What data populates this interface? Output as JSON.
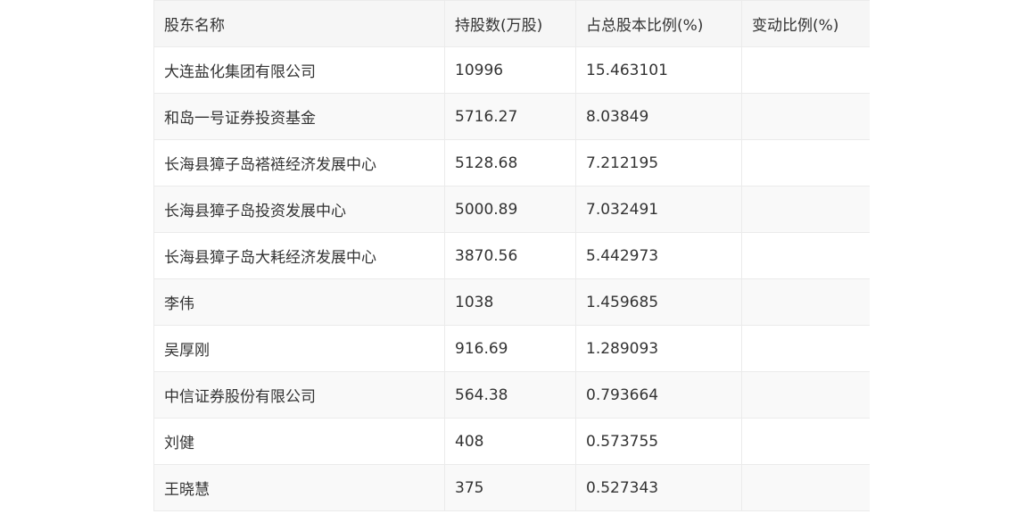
{
  "table": {
    "headers": [
      "股东名称",
      "持股数(万股)",
      "占总股本比例(%)",
      "变动比例(%)"
    ],
    "rows": [
      [
        "大连盐化集团有限公司",
        "10996",
        "15.463101",
        ""
      ],
      [
        "和岛一号证券投资基金",
        "5716.27",
        "8.03849",
        ""
      ],
      [
        "长海县獐子岛褡裢经济发展中心",
        "5128.68",
        "7.212195",
        ""
      ],
      [
        "长海县獐子岛投资发展中心",
        "5000.89",
        "7.032491",
        ""
      ],
      [
        "长海县獐子岛大耗经济发展中心",
        "3870.56",
        "5.442973",
        ""
      ],
      [
        "李伟",
        "1038",
        "1.459685",
        ""
      ],
      [
        "吴厚刚",
        "916.69",
        "1.289093",
        ""
      ],
      [
        "中信证券股份有限公司",
        "564.38",
        "0.793664",
        ""
      ],
      [
        "刘健",
        "408",
        "0.573755",
        ""
      ],
      [
        "王晓慧",
        "375",
        "0.527343",
        ""
      ]
    ]
  }
}
